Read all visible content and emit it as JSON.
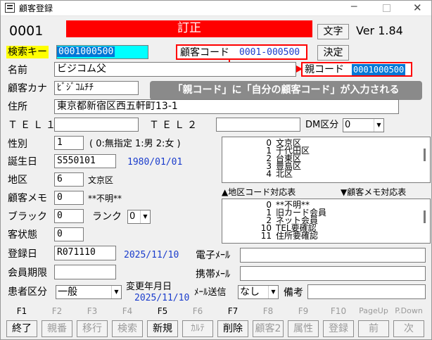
{
  "window": {
    "title": "顧客登録"
  },
  "header": {
    "id": "0001",
    "mode": "訂正",
    "moji_button": "文字",
    "version": "Ver 1.84"
  },
  "search": {
    "label": "検索キー",
    "value": "0001000500",
    "kettei": "決定"
  },
  "customer_code": {
    "label": "顧客コード",
    "value": "0001-000500"
  },
  "parent_code": {
    "label": "親コード",
    "value": "0001000500"
  },
  "callout": {
    "text": "「親コード」に「自分の顧客コード」が入力される"
  },
  "form": {
    "name_label": "名前",
    "name_value": "ビジコム父",
    "kana_label": "顧客カナ",
    "kana_value": "ﾋﾞｼﾞｺﾑﾁﾁ",
    "address_label": "住所",
    "address_value": "東京都新宿区西五軒町13-1",
    "tel1_label": "ＴＥＬ１",
    "tel1_value": "",
    "tel2_label": "ＴＥＬ２",
    "tel2_value": "",
    "dm_label": "DM区分",
    "dm_value": "0",
    "sex_label": "性別",
    "sex_value": "1",
    "sex_hint": "( 0:無指定 1:男 2:女 )",
    "birth_label": "誕生日",
    "birth_value": "S550101",
    "birth_date": "1980/01/01",
    "area_label": "地区",
    "area_value": "6",
    "area_name": "文京区",
    "memo_label": "顧客メモ",
    "memo_value": "0",
    "memo_name": "**不明**",
    "black_label": "ブラック",
    "black_value": "0",
    "rank_label": "ランク",
    "rank_value": "0",
    "status_label": "客状態",
    "status_value": "0",
    "reg_label": "登録日",
    "reg_value": "R071110",
    "reg_date": "2025/11/10",
    "member_label": "会員期限",
    "member_value": "",
    "email_label": "電子ﾒｰﾙ",
    "email_value": "",
    "mobile_label": "携帯ﾒｰﾙ",
    "mobile_value": "",
    "patient_label": "患者区分",
    "patient_value": "一般",
    "change_label": "変更年月日",
    "change_date": "2025/11/10",
    "mailsend_label": "ﾒｰﾙ送信",
    "mailsend_value": "なし",
    "remarks_label": "備考",
    "remarks_value": ""
  },
  "area_list": {
    "caption": "▲地区コード対応表",
    "rows": [
      {
        "n": "0",
        "l": "文京区"
      },
      {
        "n": "1",
        "l": "千代田区"
      },
      {
        "n": "2",
        "l": "台東区"
      },
      {
        "n": "3",
        "l": "豊島区"
      },
      {
        "n": "4",
        "l": "北区"
      }
    ]
  },
  "memo_list": {
    "caption": "▼顧客メモ対応表",
    "rows": [
      {
        "n": "0",
        "l": "**不明**"
      },
      {
        "n": "1",
        "l": "旧カード会員"
      },
      {
        "n": "2",
        "l": "ネット会員"
      },
      {
        "n": "10",
        "l": "TEL要確認"
      },
      {
        "n": "11",
        "l": "住所要確認"
      }
    ]
  },
  "fkeys": [
    {
      "key": "F1",
      "label": "終了"
    },
    {
      "key": "F2",
      "label": "親番"
    },
    {
      "key": "F3",
      "label": "移行"
    },
    {
      "key": "F4",
      "label": "検索"
    },
    {
      "key": "F5",
      "label": "新規"
    },
    {
      "key": "F6",
      "label": "ｶﾙﾃ"
    },
    {
      "key": "F7",
      "label": "削除"
    },
    {
      "key": "F8",
      "label": "顧客2"
    },
    {
      "key": "F9",
      "label": "属性"
    },
    {
      "key": "F10",
      "label": "登録"
    },
    {
      "key": "PageUp",
      "label": "前"
    },
    {
      "key": "P.Down",
      "label": "次"
    }
  ],
  "colors": {
    "red": "#ff0000",
    "highlight": "#0078d7",
    "cyan": "#00ffff",
    "yellow": "#ffff00",
    "blue_text": "#1a3ccc",
    "callout_bg": "#8a8a8a"
  }
}
